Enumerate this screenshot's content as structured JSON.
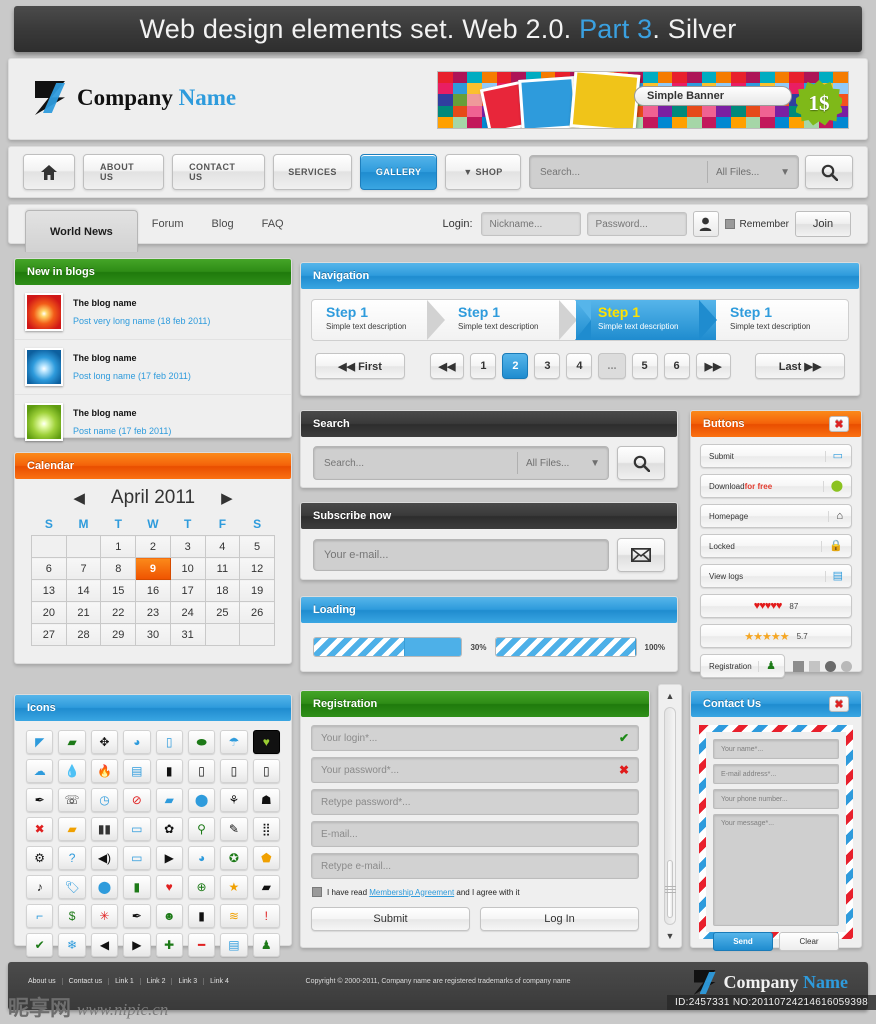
{
  "title_bar": {
    "text_before": "Web design elements set. Web 2.0. ",
    "highlight": "Part 3",
    "text_after": ". Silver",
    "accent_color": "#3aa0e0"
  },
  "header": {
    "company": "Company",
    "company_accent": "Name",
    "banner": {
      "label": "Simple Banner",
      "price_badge": "1$"
    }
  },
  "main_nav": {
    "items": [
      {
        "label": "",
        "icon": "home-icon",
        "active": false
      },
      {
        "label": "ABOUT US",
        "active": false
      },
      {
        "label": "CONTACT US",
        "active": false
      },
      {
        "label": "SERVICES",
        "active": false
      },
      {
        "label": "GALLERY",
        "active": true
      },
      {
        "label": "▼ SHOP",
        "active": false
      }
    ],
    "search": {
      "placeholder": "Search...",
      "filter": "All Files...",
      "button_icon": "search-icon"
    }
  },
  "tabs": {
    "items": [
      "World News",
      "Forum",
      "Blog",
      "FAQ"
    ],
    "active": "World News",
    "login": {
      "label": "Login:",
      "nickname_placeholder": "Nickname...",
      "password_placeholder": "Password...",
      "remember_label": "Remember",
      "join_label": "Join",
      "user_icon": "user-icon"
    }
  },
  "blogs": {
    "title": "New in blogs",
    "rows": [
      {
        "name": "The blog name",
        "post": "Post very long name (18 feb 2011)",
        "thumb": "r"
      },
      {
        "name": "The blog name",
        "post": "Post long name (17 feb 2011)",
        "thumb": "b"
      },
      {
        "name": "The blog name",
        "post": "Post name (17 feb 2011)",
        "thumb": "g"
      }
    ]
  },
  "calendar": {
    "title": "Calendar",
    "month": "April 2011",
    "prev_icon": "chevron-left-icon",
    "next_icon": "chevron-right-icon",
    "weekdays": [
      "S",
      "M",
      "T",
      "W",
      "T",
      "F",
      "S"
    ],
    "weeks": [
      [
        "",
        "",
        "1",
        "2",
        "3",
        "4",
        "5"
      ],
      [
        "6",
        "7",
        "8",
        "9",
        "10",
        "11",
        "12"
      ],
      [
        "13",
        "14",
        "15",
        "16",
        "17",
        "18",
        "19"
      ],
      [
        "20",
        "21",
        "22",
        "23",
        "24",
        "25",
        "26"
      ],
      [
        "27",
        "28",
        "29",
        "30",
        "31",
        "",
        ""
      ]
    ],
    "today": "9"
  },
  "icons_panel": {
    "title": "Icons",
    "glyphs": [
      {
        "g": "◤",
        "c": "#2e9bdc",
        "n": "flag-icon"
      },
      {
        "g": "▰",
        "c": "#1d7a18",
        "n": "folder-icon"
      },
      {
        "g": "✥",
        "c": "#111111",
        "n": "paw-icon"
      },
      {
        "g": "◕",
        "c": "#2e9bdc",
        "n": "pie-chart-icon"
      },
      {
        "g": "▯",
        "c": "#2e9bdc",
        "n": "phone-icon"
      },
      {
        "g": "⬬",
        "c": "#1d7a18",
        "n": "leaf-icon"
      },
      {
        "g": "☂",
        "c": "#2e9bdc",
        "n": "umbrella-icon"
      },
      {
        "g": "♥",
        "c": "#9acd32",
        "n": "heart-box-icon",
        "dark": true
      },
      {
        "g": "☁",
        "c": "#2e9bdc",
        "n": "cloud-icon"
      },
      {
        "g": "💧",
        "c": "#2e9bdc",
        "n": "drop-icon"
      },
      {
        "g": "🔥",
        "c": "#e02020",
        "n": "flame-icon"
      },
      {
        "g": "▤",
        "c": "#2e9bdc",
        "n": "list-icon"
      },
      {
        "g": "▮",
        "c": "#111111",
        "n": "battery-icon"
      },
      {
        "g": "▯",
        "c": "#111111",
        "n": "device-icon"
      },
      {
        "g": "▯",
        "c": "#111111",
        "n": "mobile-icon"
      },
      {
        "g": "▯",
        "c": "#111111",
        "n": "tablet-icon"
      },
      {
        "g": "✒",
        "c": "#111111",
        "n": "pen-icon"
      },
      {
        "g": "☏",
        "c": "#111111",
        "n": "telephone-icon"
      },
      {
        "g": "◷",
        "c": "#2e9bdc",
        "n": "clock-icon"
      },
      {
        "g": "⊘",
        "c": "#e02020",
        "n": "forbidden-icon"
      },
      {
        "g": "▰",
        "c": "#2e9bdc",
        "n": "briefcase-icon"
      },
      {
        "g": "⬤",
        "c": "#2e9bdc",
        "n": "lock-icon"
      },
      {
        "g": "⚘",
        "c": "#111111",
        "n": "ribbon-icon"
      },
      {
        "g": "☗",
        "c": "#111111",
        "n": "pushpin-icon"
      },
      {
        "g": "✖",
        "c": "#e02020",
        "n": "close-icon"
      },
      {
        "g": "▰",
        "c": "#f0a000",
        "n": "folder-open-icon"
      },
      {
        "g": "▮▮",
        "c": "#333333",
        "n": "pause-icon"
      },
      {
        "g": "▭",
        "c": "#2e9bdc",
        "n": "comment-icon"
      },
      {
        "g": "✿",
        "c": "#111111",
        "n": "gear-icon"
      },
      {
        "g": "⚲",
        "c": "#1d7a18",
        "n": "pin-icon"
      },
      {
        "g": "✎",
        "c": "#111111",
        "n": "brush-icon"
      },
      {
        "g": "⣿",
        "c": "#111111",
        "n": "expand-icon"
      },
      {
        "g": "⚙",
        "c": "#111111",
        "n": "sliders-icon"
      },
      {
        "g": "?",
        "c": "#2e9bdc",
        "n": "help-icon"
      },
      {
        "g": "◀)",
        "c": "#111111",
        "n": "volume-icon"
      },
      {
        "g": "▭",
        "c": "#2e9bdc",
        "n": "card-icon"
      },
      {
        "g": "▶",
        "c": "#111111",
        "n": "play-icon"
      },
      {
        "g": "◕",
        "c": "#2e9bdc",
        "n": "refresh-icon"
      },
      {
        "g": "✪",
        "c": "#1d7a18",
        "n": "shield-icon"
      },
      {
        "g": "⬟",
        "c": "#f0a000",
        "n": "badge-icon"
      },
      {
        "g": "♪",
        "c": "#111111",
        "n": "music-icon"
      },
      {
        "g": "🏷",
        "c": "#2e9bdc",
        "n": "tag-icon"
      },
      {
        "g": "⬤",
        "c": "#2e9bdc",
        "n": "circle-icon"
      },
      {
        "g": "▮",
        "c": "#1d7a18",
        "n": "bar-chart-icon"
      },
      {
        "g": "♥",
        "c": "#e02020",
        "n": "heart-icon"
      },
      {
        "g": "⊕",
        "c": "#1d7a18",
        "n": "globe-icon"
      },
      {
        "g": "★",
        "c": "#f0a000",
        "n": "star-icon"
      },
      {
        "g": "▰",
        "c": "#111111",
        "n": "video-icon"
      },
      {
        "g": "⌐",
        "c": "#2e9bdc",
        "n": "bookmark-icon"
      },
      {
        "g": "$",
        "c": "#1d7a18",
        "n": "dollar-icon"
      },
      {
        "g": "✳",
        "c": "#e02020",
        "n": "asterisk-icon"
      },
      {
        "g": "✒",
        "c": "#111111",
        "n": "cursor-icon"
      },
      {
        "g": "☻",
        "c": "#1d7a18",
        "n": "smiley-icon"
      },
      {
        "g": "▮",
        "c": "#111111",
        "n": "clipboard-icon"
      },
      {
        "g": "≋",
        "c": "#f0a000",
        "n": "rss-icon"
      },
      {
        "g": "!",
        "c": "#e02020",
        "n": "alert-icon"
      },
      {
        "g": "✔",
        "c": "#1d7a18",
        "n": "check-icon"
      },
      {
        "g": "❄",
        "c": "#2e9bdc",
        "n": "snowflake-icon"
      },
      {
        "g": "◀",
        "c": "#111111",
        "n": "arrow-left-icon"
      },
      {
        "g": "▶",
        "c": "#111111",
        "n": "arrow-right-icon"
      },
      {
        "g": "✚",
        "c": "#1d7a18",
        "n": "plus-icon"
      },
      {
        "g": "━",
        "c": "#e02020",
        "n": "minus-icon"
      },
      {
        "g": "▤",
        "c": "#2e9bdc",
        "n": "save-icon"
      },
      {
        "g": "♟",
        "c": "#1d7a18",
        "n": "user-pawn-icon"
      }
    ]
  },
  "navigation": {
    "title": "Navigation",
    "steps": [
      {
        "title": "Step 1",
        "desc": "Simple text description",
        "active": false
      },
      {
        "title": "Step 1",
        "desc": "Simple text description",
        "active": false
      },
      {
        "title": "Step 1",
        "desc": "Simple text description",
        "active": true
      },
      {
        "title": "Step 1",
        "desc": "Simple text description",
        "active": false
      }
    ],
    "pager": {
      "first": "◀◀ First",
      "prev": "◀◀",
      "pages": [
        "1",
        "2",
        "3",
        "4",
        "...",
        "5",
        "6"
      ],
      "current": "2",
      "next": "▶▶",
      "last": "Last ▶▶"
    }
  },
  "search_panel": {
    "title": "Search",
    "placeholder": "Search...",
    "filter": "All Files...",
    "button_icon": "search-icon"
  },
  "subscribe": {
    "title": "Subscribe now",
    "placeholder": "Your e-mail...",
    "button_icon": "envelope-icon"
  },
  "loading": {
    "title": "Loading",
    "bars": [
      {
        "percent": 30,
        "label": "30%"
      },
      {
        "percent": 100,
        "label": "100%"
      }
    ]
  },
  "buttons_panel": {
    "title": "Buttons",
    "close_icon": "close-icon",
    "rows": [
      {
        "label": "Submit",
        "icon": "card-icon"
      },
      {
        "label": "Download ",
        "label_accent": "for free",
        "icon": "download-icon"
      },
      {
        "label": "Homepage",
        "icon": "home-icon"
      },
      {
        "label": "Locked",
        "icon": "lock-icon"
      },
      {
        "label": "View logs",
        "icon": "document-icon"
      }
    ],
    "hearts": {
      "glyphs": "♥♥♥♥♥",
      "value": "87"
    },
    "stars": {
      "glyphs": "★★★★★",
      "value": "5.7"
    },
    "registration": {
      "label": "Registration",
      "icon": "user-icon"
    }
  },
  "registration": {
    "title": "Registration",
    "fields": [
      {
        "placeholder": "Your login*...",
        "status": "ok",
        "mark": "✔"
      },
      {
        "placeholder": "Your password*...",
        "status": "bad",
        "mark": "✖"
      },
      {
        "placeholder": "Retype password*...",
        "status": "",
        "mark": ""
      },
      {
        "placeholder": "E-mail...",
        "status": "",
        "mark": ""
      },
      {
        "placeholder": "Retype e-mail...",
        "status": "",
        "mark": ""
      }
    ],
    "agree_before": "I have read ",
    "agree_link": "Membership Agreement",
    "agree_after": " and I agree with it",
    "submit": "Submit",
    "login": "Log In"
  },
  "contact": {
    "title": "Contact Us",
    "close_icon": "close-icon",
    "fields": [
      "Your name*...",
      "E-mail address*...",
      "Your phone number..."
    ],
    "message_placeholder": "Your message*...",
    "send": "Send",
    "clear": "Clear"
  },
  "footer": {
    "links": [
      "About us",
      "Contact us",
      "Link 1",
      "Link 2",
      "Link 3",
      "Link 4"
    ],
    "copyright": "Copyright © 2000-2011, Company name are registered trademarks of company name",
    "company": "Company",
    "company_accent": "Name"
  },
  "watermark": {
    "site_cn": "昵享网",
    "site_url": "www.nipic.cn",
    "id_text": "ID:2457331 NO:20110724214616059398"
  }
}
